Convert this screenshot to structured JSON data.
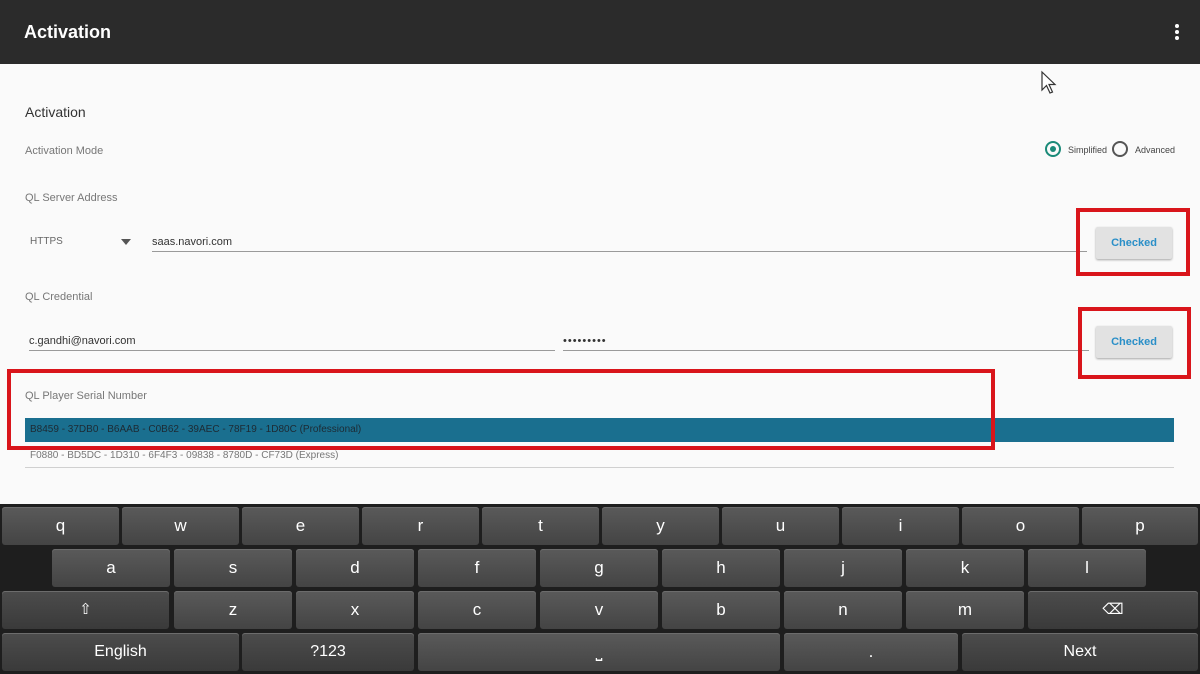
{
  "appbar": {
    "title": "Activation"
  },
  "section": {
    "title": "Activation"
  },
  "activation_mode": {
    "label": "Activation Mode",
    "options": [
      {
        "label": "Simplified",
        "selected": true
      },
      {
        "label": "Advanced",
        "selected": false
      }
    ]
  },
  "server": {
    "label": "QL Server Address",
    "protocol": "HTTPS",
    "address": "saas.navori.com",
    "button": "Checked"
  },
  "credential": {
    "label": "QL Credential",
    "email": "c.gandhi@navori.com",
    "password": "•••••••••",
    "button": "Checked"
  },
  "serial": {
    "label": "QL Player Serial Number",
    "items": [
      "B8459 - 37DB0 - B6AAB - C0B62 - 39AEC - 78F19 - 1D80C (Professional)",
      "F0880 - BD5DC - 1D310 - 6F4F3 - 09838 - 8780D - CF73D (Express)"
    ],
    "selected_index": 0
  },
  "keyboard": {
    "row1": [
      "q",
      "w",
      "e",
      "r",
      "t",
      "y",
      "u",
      "i",
      "o",
      "p"
    ],
    "row2": [
      "a",
      "s",
      "d",
      "f",
      "g",
      "h",
      "j",
      "k",
      "l"
    ],
    "row3": [
      "z",
      "x",
      "c",
      "v",
      "b",
      "n",
      "m"
    ],
    "language": "English",
    "symbols": "?123",
    "space": "⎵",
    "period": ".",
    "next": "Next",
    "shift_icon": "⇧",
    "delete_icon": "⌫"
  },
  "colors": {
    "accent": "#1a8a78",
    "highlight_box": "#d9151b",
    "selected_row": "#1a6f8f",
    "button_text": "#2a8fc8"
  }
}
